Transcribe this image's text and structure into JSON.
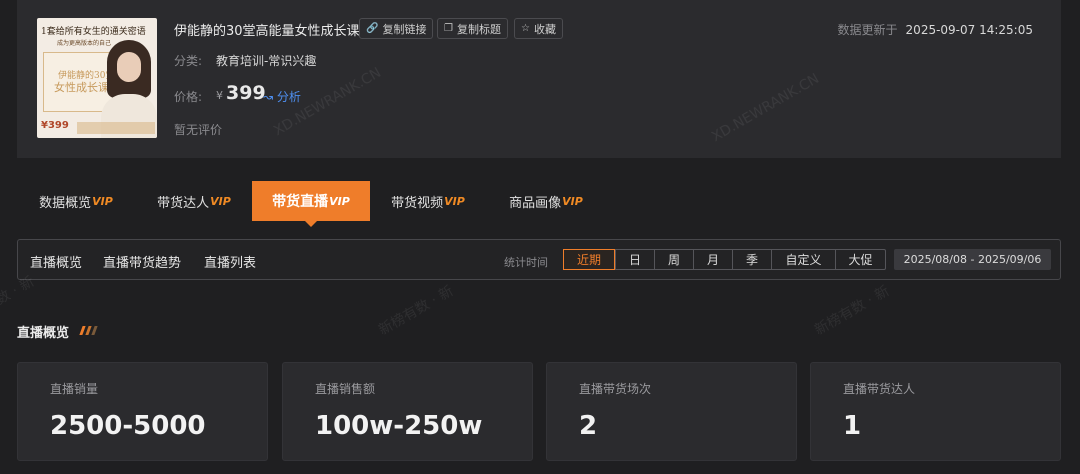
{
  "product": {
    "title": "伊能静的30堂高能量女性成长课",
    "thumb_text_top": "1套给所有女生的通关密语",
    "thumb_text_sub": "成为更高版本的自己",
    "thumb_book_text_1": "伊能静的30堂",
    "thumb_book_text_2": "女性成长课",
    "thumb_price": "¥399",
    "copy_link_label": "复制链接",
    "copy_title_label": "复制标题",
    "favorite_label": "收藏",
    "category_label": "分类:",
    "category_value": "教育培训-常识兴趣",
    "price_label": "价格:",
    "price_currency": "¥",
    "price_value": "399",
    "analyze_label": "分析",
    "review_text": "暂无评价",
    "updated_label": "数据更新于",
    "updated_value": "2025-09-07 14:25:05"
  },
  "watermarks": [
    "XD.NEWRANK.CN",
    "XD.NEWRANK.CN",
    "新榜有数 · 新",
    "新榜有数 · 新",
    "数 · 新"
  ],
  "tabs": [
    {
      "label": "数据概览",
      "vip": "VIP",
      "active": false
    },
    {
      "label": "带货达人",
      "vip": "VIP",
      "active": false
    },
    {
      "label": "带货直播",
      "vip": "VIP",
      "active": true
    },
    {
      "label": "带货视频",
      "vip": "VIP",
      "active": false
    },
    {
      "label": "商品画像",
      "vip": "VIP",
      "active": false
    }
  ],
  "subnav": {
    "links": [
      "直播概览",
      "直播带货趋势",
      "直播列表"
    ],
    "stat_time_label": "统计时间",
    "periods": [
      "近期",
      "日",
      "周",
      "月",
      "季",
      "自定义",
      "大促"
    ],
    "active_period": "近期",
    "date_range": "2025/08/08  -  2025/09/06"
  },
  "section": {
    "title": "直播概览"
  },
  "metrics": [
    {
      "label": "直播销量",
      "value": "2500-5000"
    },
    {
      "label": "直播销售额",
      "value": "100w-250w"
    },
    {
      "label": "直播带货场次",
      "value": "2"
    },
    {
      "label": "直播带货达人",
      "value": "1"
    }
  ],
  "colors": {
    "accent": "#ef7d2a",
    "link": "#4e8ff0",
    "background": "#1f1f21",
    "card": "#2b2b2e"
  }
}
